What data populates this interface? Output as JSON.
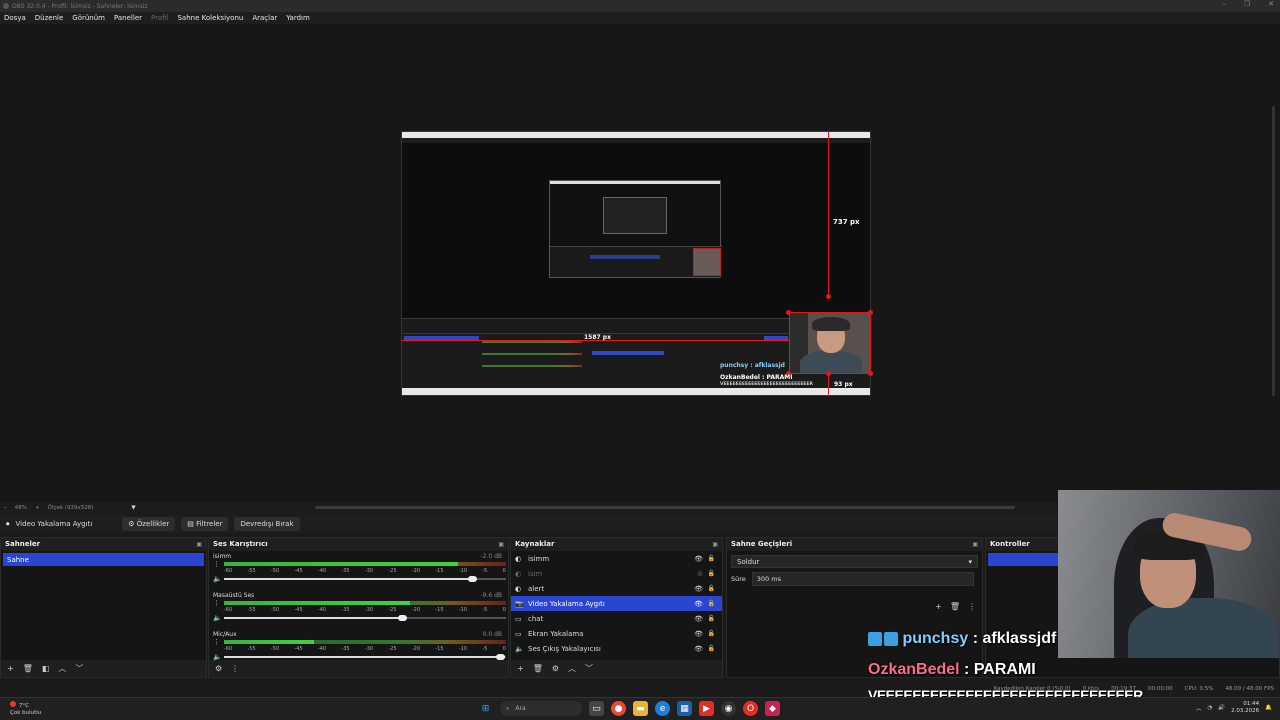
{
  "window": {
    "title": "OBS 32.0.4 - Profil: İsimsiz - Sahneler: İsimsiz",
    "controls": [
      "–",
      "❐",
      "✕"
    ]
  },
  "menu": {
    "items": [
      "Dosya",
      "Düzenle",
      "Görünüm",
      "Paneller",
      "Profil",
      "Sahne Koleksiyonu",
      "Araçlar",
      "Yardım"
    ]
  },
  "preview": {
    "measure_vertical": "737 px",
    "measure_horizontal": "1587 px",
    "measure_bottom": "93 px",
    "mini_chat_user": "punchsy : afklassjd",
    "mini_chat_user2": "OzkanBedel : PARAMI",
    "mini_chat_line3": "VEEEEEEEEEEEEEEEEEEEEEEEEEEEER"
  },
  "zoom": {
    "percent": "48%",
    "fit": "Ölçek (939x528)"
  },
  "source_toolbar": {
    "source_name": "Video Yakalama Aygıtı",
    "properties": "Özellikler",
    "filters": "Filtreler",
    "deactivate": "Devredışı Bırak"
  },
  "scenes": {
    "title": "Sahneler",
    "items": [
      "Sahne"
    ]
  },
  "mixer": {
    "title": "Ses Karıştırıcı",
    "ticks": [
      "-60",
      "-55",
      "-50",
      "-45",
      "-40",
      "-35",
      "-30",
      "-25",
      "-20",
      "-15",
      "-10",
      "-5",
      "0"
    ],
    "channels": [
      {
        "name": "isimm",
        "db": "-2.0 dB",
        "level": 0.83,
        "volume": 0.88
      },
      {
        "name": "Masaüstü Ses",
        "db": "-9.6 dB",
        "level": 0.66,
        "volume": 0.63
      },
      {
        "name": "Mic/Aux",
        "db": "0.0 dB",
        "level": 0.32,
        "volume": 0.98
      }
    ]
  },
  "sources": {
    "title": "Kaynaklar",
    "items": [
      {
        "name": "isimm",
        "state": "normal"
      },
      {
        "name": "isim",
        "state": "hidden"
      },
      {
        "name": "alert",
        "state": "normal"
      },
      {
        "name": "Video Yakalama Aygıtı",
        "state": "selected"
      },
      {
        "name": "chat",
        "state": "normal"
      },
      {
        "name": "Ekran Yakalama",
        "state": "normal"
      },
      {
        "name": "Ses Çıkış Yakalayıcısı",
        "state": "normal"
      }
    ]
  },
  "transitions": {
    "title": "Sahne Geçişleri",
    "selected": "Soldur",
    "duration_label": "Süre",
    "duration_value": "300 ms"
  },
  "controls": {
    "title": "Kontroller"
  },
  "overlay": {
    "chat1_user": "punchsy",
    "chat1_msg": ": afklassjdf",
    "chat2_user": "OzkanBedel",
    "chat2_msg": ": PARAMI",
    "chat3": "VEEEEEEEEEEEEEEEEEEEEEEEEEEEEER",
    "chat2_color": "#ff6b8a",
    "chat1_color": "#7fd0ff"
  },
  "statusbar": {
    "frames": "Kaydedilen Kareler 0 (%0.0)",
    "bitrate": "0 kb/s",
    "stream_time": "00:19:37",
    "rec_time": "00:00:00",
    "cpu": "CPU: 0.5%",
    "fps": "48.00 / 48.00 FPS"
  },
  "taskbar": {
    "weather_temp": "7°C",
    "weather_desc": "Çok bulutlu",
    "search": "Ara",
    "time": "01:44",
    "date": "2.03.2026"
  },
  "colors": {
    "accent": "#2a45d0",
    "selection_red": "#e01818"
  }
}
